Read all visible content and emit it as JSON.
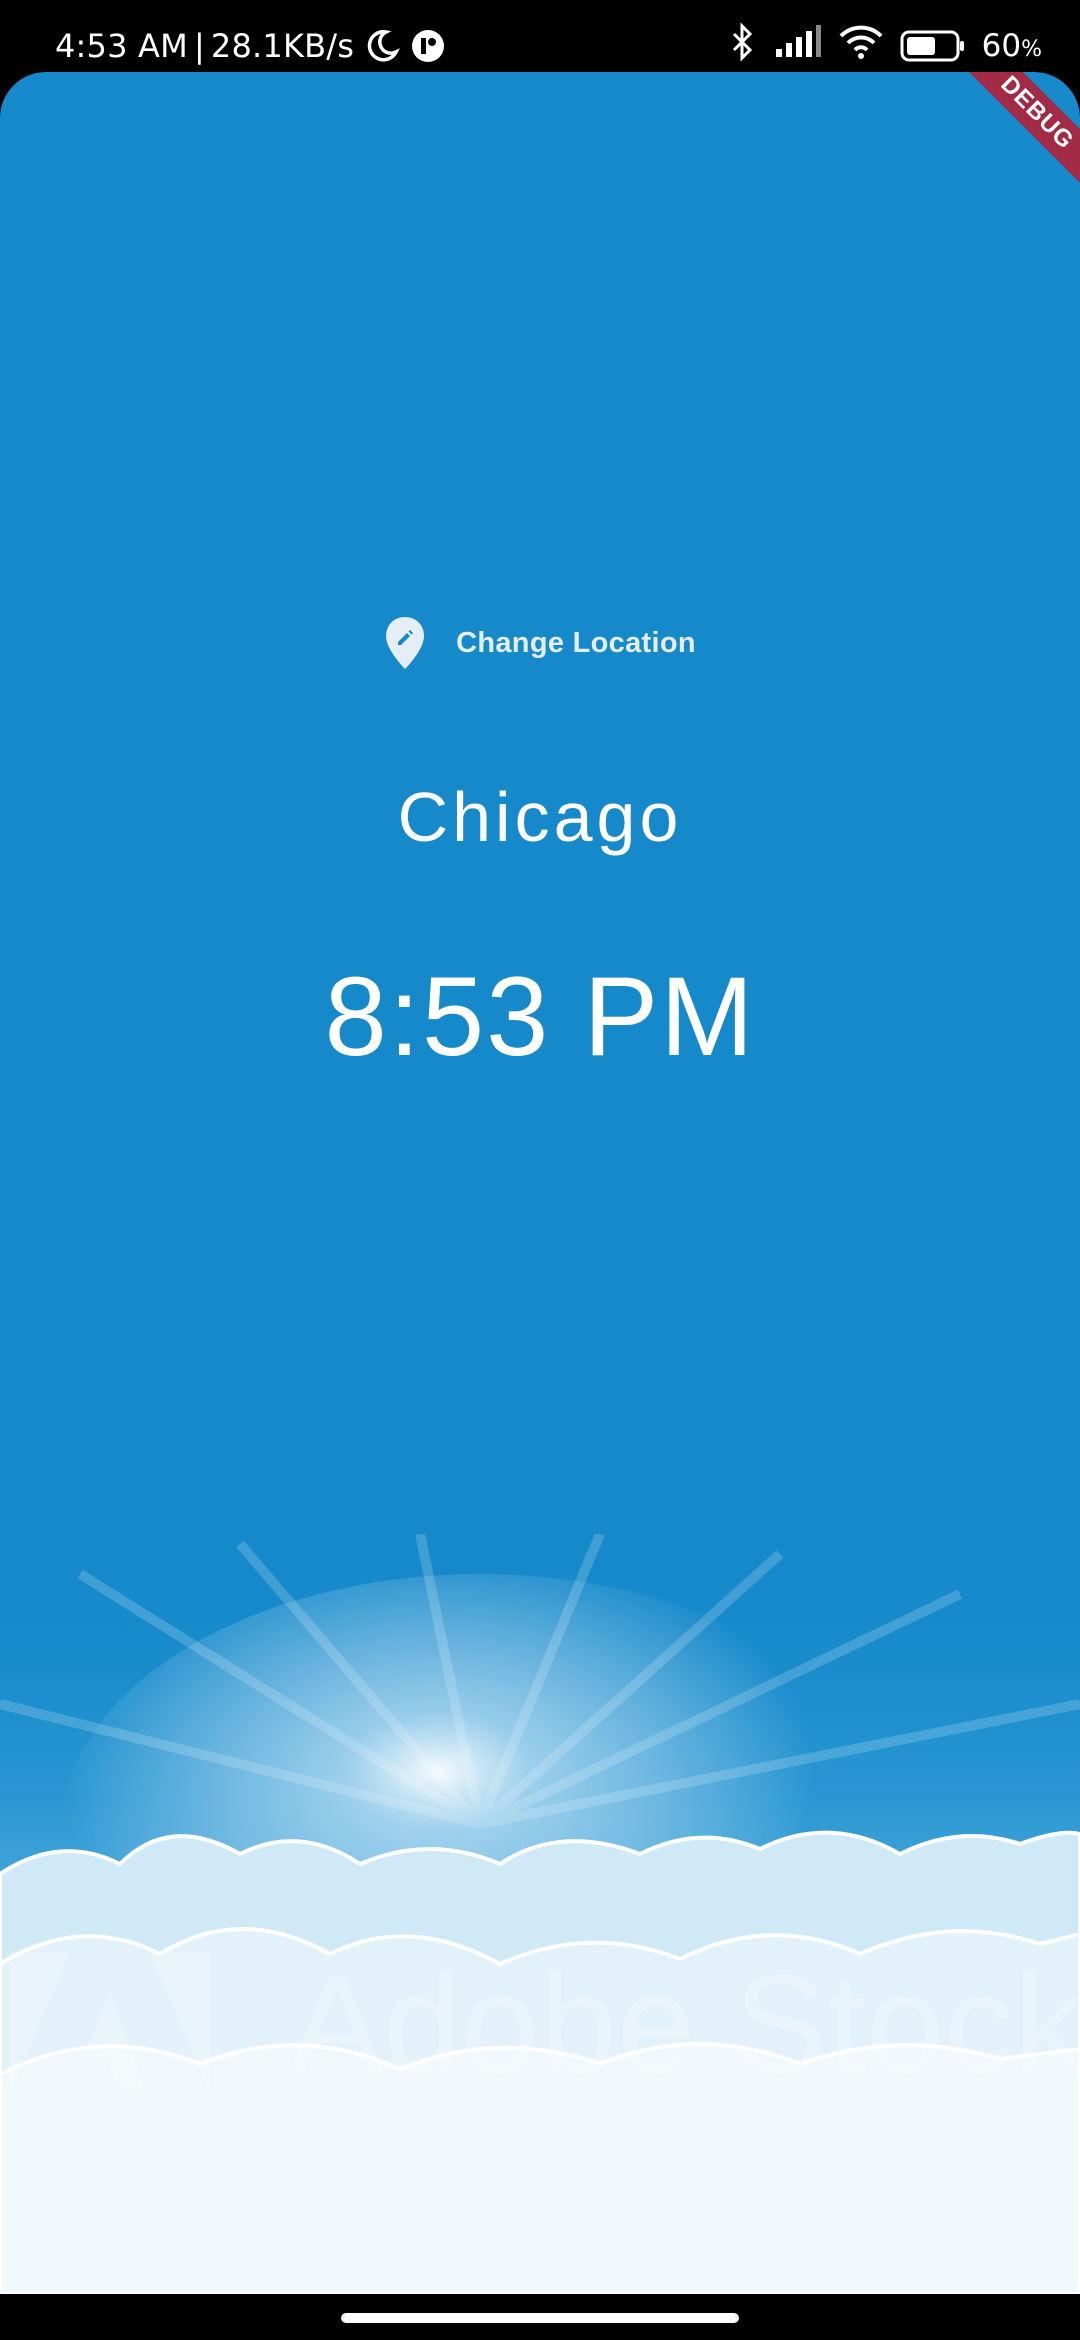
{
  "status_bar": {
    "time": "4:53 AM",
    "separator": "|",
    "network_speed": "28.1KB/s",
    "battery_percent": "60",
    "battery_unit": "%",
    "battery_level": 0.6,
    "icons": [
      "moon-icon",
      "app-notification-icon",
      "bluetooth-icon",
      "signal-icon",
      "wifi-icon",
      "battery-icon"
    ]
  },
  "app": {
    "background_color": "#1589ca",
    "debug_banner": "DEBUG",
    "change_location_label": "Change Location",
    "location_icon": "edit-location-icon",
    "city": "Chicago",
    "time": "8:53 PM",
    "watermark_text": "Adobe Stock"
  }
}
